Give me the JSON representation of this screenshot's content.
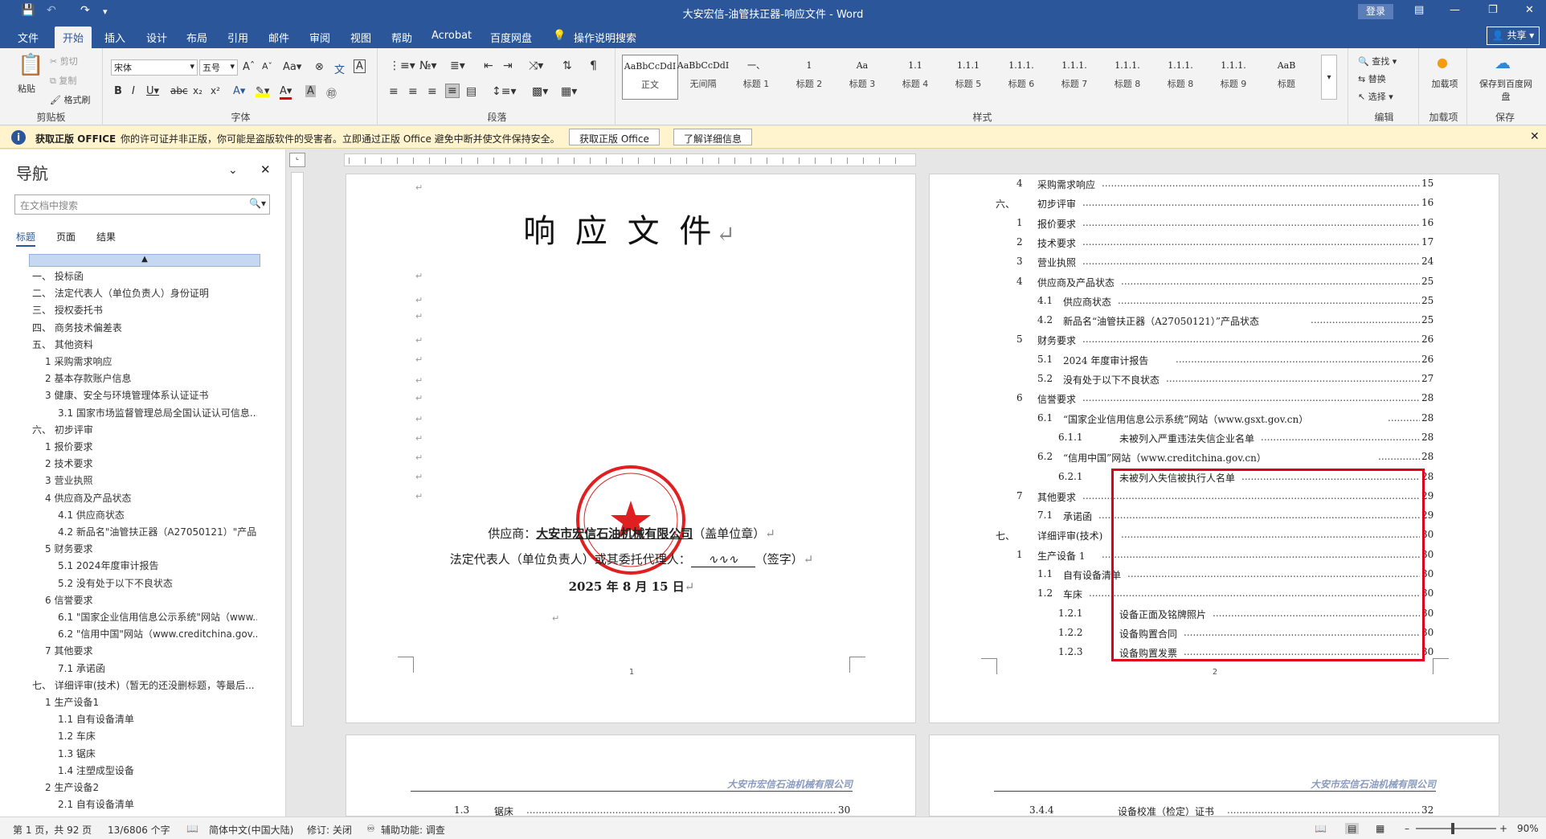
{
  "window": {
    "title": "大安宏信-油管扶正器-响应文件 - Word",
    "login": "登录"
  },
  "menu": {
    "items": [
      "文件",
      "开始",
      "插入",
      "设计",
      "布局",
      "引用",
      "邮件",
      "审阅",
      "视图",
      "帮助",
      "Acrobat",
      "百度网盘"
    ],
    "tell_me": "操作说明搜索",
    "share": "共享"
  },
  "ribbon": {
    "clipboard": {
      "paste": "粘贴",
      "cut": "剪切",
      "copy": "复制",
      "format_painter": "格式刷",
      "label": "剪贴板"
    },
    "font": {
      "name": "宋体",
      "size": "五号",
      "label": "字体"
    },
    "paragraph": {
      "label": "段落"
    },
    "styles": {
      "label": "样式",
      "items": [
        {
          "preview": "AaBbCcDdI",
          "name": "正文"
        },
        {
          "preview": "AaBbCcDdI",
          "name": "无间隔"
        },
        {
          "preview": "一、",
          "name": "标题 1"
        },
        {
          "preview": "1",
          "name": "标题 2"
        },
        {
          "preview": "Aa",
          "name": "标题 3"
        },
        {
          "preview": "1.1",
          "name": "标题 4"
        },
        {
          "preview": "1.1.1",
          "name": "标题 5"
        },
        {
          "preview": "1.1.1.",
          "name": "标题 6"
        },
        {
          "preview": "1.1.1.",
          "name": "标题 7"
        },
        {
          "preview": "1.1.1.",
          "name": "标题 8"
        },
        {
          "preview": "1.1.1.",
          "name": "标题 8"
        },
        {
          "preview": "1.1.1.",
          "name": "标题 9"
        },
        {
          "preview": "AaB",
          "name": "标题"
        }
      ]
    },
    "editing": {
      "find": "查找",
      "replace": "替换",
      "select": "选择",
      "label": "编辑"
    },
    "addins": {
      "btn": "加载项",
      "label": "加载项"
    },
    "save": {
      "btn": "保存到百度网盘",
      "label": "保存"
    }
  },
  "msgbar": {
    "bold": "获取正版 OFFICE",
    "text": "你的许可证并非正版，你可能是盗版软件的受害者。立即通过正版 Office 避免中断并使文件保持安全。",
    "btn1": "获取正版 Office",
    "btn2": "了解详细信息"
  },
  "nav": {
    "title": "导航",
    "search_placeholder": "在文档中搜索",
    "tabs": [
      "标题",
      "页面",
      "结果"
    ],
    "items": [
      {
        "text": "一、 投标函",
        "lvl": 1,
        "tw": ""
      },
      {
        "text": "二、 法定代表人（单位负责人）身份证明",
        "lvl": 1,
        "tw": ""
      },
      {
        "text": "三、 授权委托书",
        "lvl": 1,
        "tw": ""
      },
      {
        "text": "四、 商务技术偏差表",
        "lvl": 1,
        "tw": ""
      },
      {
        "text": "五、 其他资料",
        "lvl": 1,
        "tw": "open"
      },
      {
        "text": "1 采购需求响应",
        "lvl": 2,
        "tw": ""
      },
      {
        "text": "2 基本存款账户信息",
        "lvl": 2,
        "tw": ""
      },
      {
        "text": "3 健康、安全与环境管理体系认证证书",
        "lvl": 2,
        "tw": "open"
      },
      {
        "text": "3.1 国家市场监督管理总局全国认证认可信息...",
        "lvl": 3,
        "tw": ""
      },
      {
        "text": "六、 初步评审",
        "lvl": 1,
        "tw": "open"
      },
      {
        "text": "1 报价要求",
        "lvl": 2,
        "tw": ""
      },
      {
        "text": "2 技术要求",
        "lvl": 2,
        "tw": ""
      },
      {
        "text": "3 营业执照",
        "lvl": 2,
        "tw": ""
      },
      {
        "text": "4 供应商及产品状态",
        "lvl": 2,
        "tw": "open"
      },
      {
        "text": "4.1 供应商状态",
        "lvl": 3,
        "tw": ""
      },
      {
        "text": "4.2 新品名\"油管扶正器（A27050121）\"产品...",
        "lvl": 3,
        "tw": ""
      },
      {
        "text": "5 财务要求",
        "lvl": 2,
        "tw": "open"
      },
      {
        "text": "5.1 2024年度审计报告",
        "lvl": 3,
        "tw": ""
      },
      {
        "text": "5.2 没有处于以下不良状态",
        "lvl": 3,
        "tw": "closed"
      },
      {
        "text": "6 信誉要求",
        "lvl": 2,
        "tw": "open"
      },
      {
        "text": "6.1 \"国家企业信用信息公示系统\"网站（www....",
        "lvl": 3,
        "tw": "closed"
      },
      {
        "text": "6.2 \"信用中国\"网站（www.creditchina.gov....",
        "lvl": 3,
        "tw": "closed"
      },
      {
        "text": "7 其他要求",
        "lvl": 2,
        "tw": "open"
      },
      {
        "text": "7.1 承诺函",
        "lvl": 3,
        "tw": ""
      },
      {
        "text": "七、 详细评审(技术)（暂无的还没删标题，等最后...",
        "lvl": 1,
        "tw": "open"
      },
      {
        "text": "1 生产设备1",
        "lvl": 2,
        "tw": "open"
      },
      {
        "text": "1.1 自有设备清单",
        "lvl": 3,
        "tw": ""
      },
      {
        "text": "1.2 车床",
        "lvl": 3,
        "tw": "closed"
      },
      {
        "text": "1.3 锯床",
        "lvl": 3,
        "tw": "closed"
      },
      {
        "text": "1.4 注塑成型设备",
        "lvl": 3,
        "tw": "closed"
      },
      {
        "text": "2 生产设备2",
        "lvl": 2,
        "tw": "open"
      },
      {
        "text": "2.1 自有设备清单",
        "lvl": 3,
        "tw": ""
      }
    ]
  },
  "page1": {
    "title": "响 应 文 件",
    "supplier_label": "供应商：",
    "supplier_name": "大安市宏信石油机械有限公司",
    "supplier_suffix": "（盖单位章）",
    "rep_label": "法定代表人（单位负责人）或其委托代理人：",
    "rep_suffix": "（签字）",
    "date": "2025 年 8 月 15 日",
    "page_no": "1",
    "seal_text": "大安市宏信石油机械有限公司"
  },
  "page2": {
    "page_no": "2",
    "toc": [
      {
        "n": "4",
        "t": "采购需求响应",
        "p": "15",
        "lvl": 2
      },
      {
        "n": "六、",
        "t": "初步评审",
        "p": "16",
        "lvl": 1
      },
      {
        "n": "1",
        "t": "报价要求",
        "p": "16",
        "lvl": 2
      },
      {
        "n": "2",
        "t": "技术要求",
        "p": "17",
        "lvl": 2
      },
      {
        "n": "3",
        "t": "营业执照",
        "p": "24",
        "lvl": 2
      },
      {
        "n": "4",
        "t": "供应商及产品状态",
        "p": "25",
        "lvl": 2
      },
      {
        "n": "4.1",
        "t": "供应商状态",
        "p": "25",
        "lvl": 3
      },
      {
        "n": "4.2",
        "t": "新品名“油管扶正器（A27050121）”产品状态",
        "p": "25",
        "lvl": 3
      },
      {
        "n": "5",
        "t": "财务要求",
        "p": "26",
        "lvl": 2
      },
      {
        "n": "5.1",
        "t": "2024 年度审计报告",
        "p": "26",
        "lvl": 3
      },
      {
        "n": "5.2",
        "t": "没有处于以下不良状态",
        "p": "27",
        "lvl": 3
      },
      {
        "n": "6",
        "t": "信誉要求",
        "p": "28",
        "lvl": 2
      },
      {
        "n": "6.1",
        "t": "“国家企业信用信息公示系统”网站（www.gsxt.gov.cn）",
        "p": "28",
        "lvl": 3
      },
      {
        "n": "6.1.1",
        "t": "未被列入严重违法失信企业名单",
        "p": "28",
        "lvl": 4
      },
      {
        "n": "6.2",
        "t": "“信用中国”网站（www.creditchina.gov.cn）",
        "p": "28",
        "lvl": 3
      },
      {
        "n": "6.2.1",
        "t": "未被列入失信被执行人名单",
        "p": "28",
        "lvl": 4
      },
      {
        "n": "7",
        "t": "其他要求",
        "p": "29",
        "lvl": 2
      },
      {
        "n": "7.1",
        "t": "承诺函",
        "p": "29",
        "lvl": 3
      },
      {
        "n": "七、",
        "t": "详细评审(技术)",
        "p": "30",
        "lvl": 1
      },
      {
        "n": "1",
        "t": "生产设备 1",
        "p": "30",
        "lvl": 2
      },
      {
        "n": "1.1",
        "t": "自有设备清单",
        "p": "30",
        "lvl": 3
      },
      {
        "n": "1.2",
        "t": "车床",
        "p": "30",
        "lvl": 3
      },
      {
        "n": "1.2.1",
        "t": "设备正面及铭牌照片",
        "p": "30",
        "lvl": 4
      },
      {
        "n": "1.2.2",
        "t": "设备购置合同",
        "p": "30",
        "lvl": 4
      },
      {
        "n": "1.2.3",
        "t": "设备购置发票",
        "p": "30",
        "lvl": 4
      }
    ]
  },
  "page3": {
    "header": "大安市宏信石油机械有限公司",
    "toc_n": "1.3",
    "toc_t": "锯床",
    "toc_p": "30"
  },
  "page4": {
    "header": "大安市宏信石油机械有限公司",
    "toc_n": "3.4.4",
    "toc_t": "设备校准（检定）证书",
    "toc_p": "32"
  },
  "status": {
    "page": "第 1 页，共 92 页",
    "words": "13/6806 个字",
    "lang": "简体中文(中国大陆)",
    "track": "修订: 关闭",
    "access": "辅助功能: 调查",
    "zoom": "90%"
  },
  "colors": {
    "accent": "#2b579a",
    "highlight": "#e0001b",
    "seal": "#e02020"
  }
}
